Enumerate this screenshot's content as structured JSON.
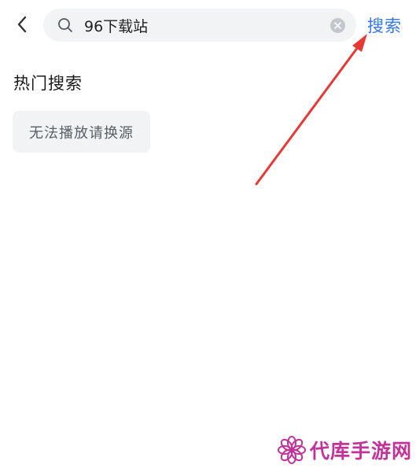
{
  "header": {
    "search_value": "96下载站",
    "search_action_label": "搜索"
  },
  "hot_search": {
    "title": "热门搜索",
    "tags": [
      "无法播放请换源"
    ]
  },
  "watermark": {
    "text": "代库手游网"
  },
  "colors": {
    "accent": "#3478e5",
    "annotation_arrow": "#e53935",
    "watermark": "#c2339a",
    "chip_bg": "#f2f3f5"
  },
  "icons": {
    "back": "chevron-left-icon",
    "search": "search-icon",
    "clear": "clear-icon",
    "logo": "flower-logo-icon"
  }
}
